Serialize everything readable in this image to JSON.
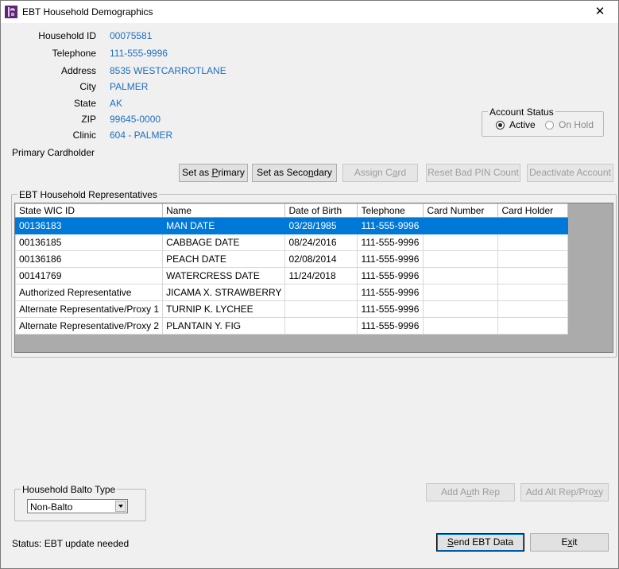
{
  "window": {
    "title": "EBT Household Demographics",
    "close_glyph": "✕",
    "icon": "app-icon"
  },
  "household": {
    "fields": [
      {
        "label": "Household ID",
        "value": "00075581"
      },
      {
        "label": "Telephone",
        "value": "111-555-9996"
      },
      {
        "label": "Address",
        "value": "8535 WESTCARROTLANE"
      },
      {
        "label": "City",
        "value": "PALMER"
      },
      {
        "label": "State",
        "value": "AK"
      },
      {
        "label": "ZIP",
        "value": "99645-0000"
      },
      {
        "label": "Clinic",
        "value": "604 - PALMER"
      }
    ],
    "primary_cardholder_label": "Primary Cardholder",
    "primary_cardholder_value": ""
  },
  "account_status": {
    "title": "Account Status",
    "options": [
      {
        "label": "Active",
        "checked": true,
        "enabled": true
      },
      {
        "label": "On Hold",
        "checked": false,
        "enabled": false
      }
    ]
  },
  "actions": {
    "set_primary": {
      "pre": "Set as ",
      "mn": "P",
      "post": "rimary"
    },
    "set_secondary": {
      "pre": "Set as Seco",
      "mn": "n",
      "post": "dary"
    },
    "assign_card": {
      "pre": "Assign C",
      "mn": "a",
      "post": "rd"
    },
    "reset_pin": {
      "pre": "Reset Bad PIN Count",
      "mn": "",
      "post": ""
    },
    "deactivate": {
      "pre": "Deactivate Account",
      "mn": "",
      "post": ""
    }
  },
  "representatives": {
    "title": "EBT Household Representatives",
    "columns": [
      "State WIC ID",
      "Name",
      "Date of Birth",
      "Telephone",
      "Card Number",
      "Card Holder"
    ],
    "rows": [
      [
        "00136183",
        "MAN DATE",
        "03/28/1985",
        "111-555-9996",
        "",
        ""
      ],
      [
        "00136185",
        "CABBAGE DATE",
        "08/24/2016",
        "111-555-9996",
        "",
        ""
      ],
      [
        "00136186",
        "PEACH DATE",
        "02/08/2014",
        "111-555-9996",
        "",
        ""
      ],
      [
        "00141769",
        "WATERCRESS DATE",
        "11/24/2018",
        "111-555-9996",
        "",
        ""
      ],
      [
        "Authorized Representative",
        "JICAMA X. STRAWBERRY",
        "",
        "111-555-9996",
        "",
        ""
      ],
      [
        "Alternate Representative/Proxy 1",
        "TURNIP K. LYCHEE",
        "",
        "111-555-9996",
        "",
        ""
      ],
      [
        "Alternate Representative/Proxy 2",
        "PLANTAIN Y. FIG",
        "",
        "111-555-9996",
        "",
        ""
      ]
    ],
    "selected_row": 0
  },
  "balto": {
    "title": "Household Balto Type",
    "selected": "Non-Balto"
  },
  "bottom_buttons": {
    "add_auth_rep": {
      "pre": "Add A",
      "mn": "u",
      "post": "th Rep"
    },
    "add_alt_rep": {
      "pre": "Add Alt Rep/Pro",
      "mn": "x",
      "post": "y"
    },
    "send_ebt": {
      "pre": "",
      "mn": "S",
      "post": "end EBT Data"
    },
    "exit": {
      "pre": "E",
      "mn": "x",
      "post": "it"
    }
  },
  "status": {
    "text": "Status: EBT update needed"
  },
  "colors": {
    "link_value": "#1f6fc0",
    "selection": "#0078d7",
    "grid_background": "#ababab"
  }
}
